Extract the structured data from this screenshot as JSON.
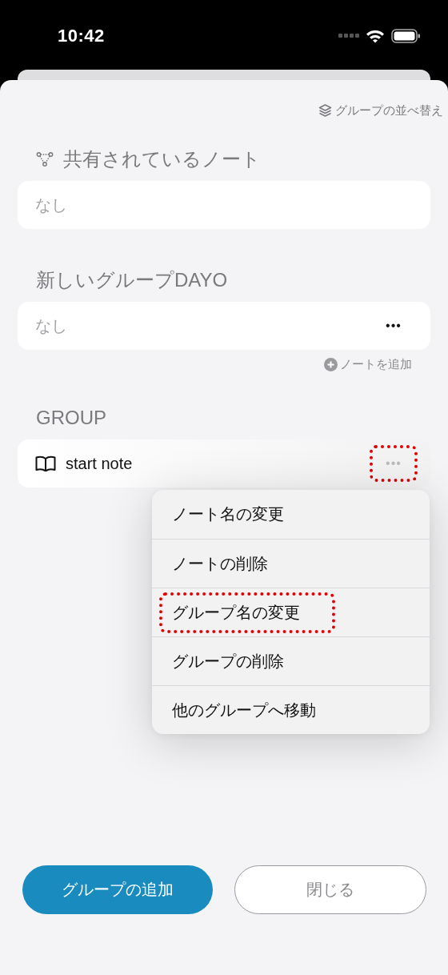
{
  "status_bar": {
    "time": "10:42"
  },
  "reorder_link": {
    "label": "グループの並べ替え"
  },
  "sections": [
    {
      "kind": "shared",
      "title": "共有されているノート",
      "rows": [
        {
          "kind": "empty",
          "text": "なし"
        }
      ]
    },
    {
      "kind": "group",
      "title": "新しいグループDAYO",
      "rows": [
        {
          "kind": "empty",
          "text": "なし",
          "more": {
            "text": "•••",
            "dimmed": false,
            "highlighted": false
          }
        }
      ],
      "add_note": "ノートを追加"
    },
    {
      "kind": "group",
      "title": "GROUP",
      "rows": [
        {
          "kind": "note",
          "text": "start note",
          "more": {
            "text": "•••",
            "dimmed": true,
            "highlighted": true
          }
        }
      ]
    }
  ],
  "context_menu": {
    "items": [
      {
        "label": "ノート名の変更",
        "highlighted": false
      },
      {
        "label": "ノートの削除",
        "highlighted": false
      },
      {
        "label": "グループ名の変更",
        "highlighted": true
      },
      {
        "label": "グループの削除",
        "highlighted": false
      },
      {
        "label": "他のグループへ移動",
        "highlighted": false
      }
    ]
  },
  "buttons": [
    {
      "label": "グループの追加",
      "kind": "primary"
    },
    {
      "label": "閉じる",
      "kind": "secondary"
    }
  ]
}
